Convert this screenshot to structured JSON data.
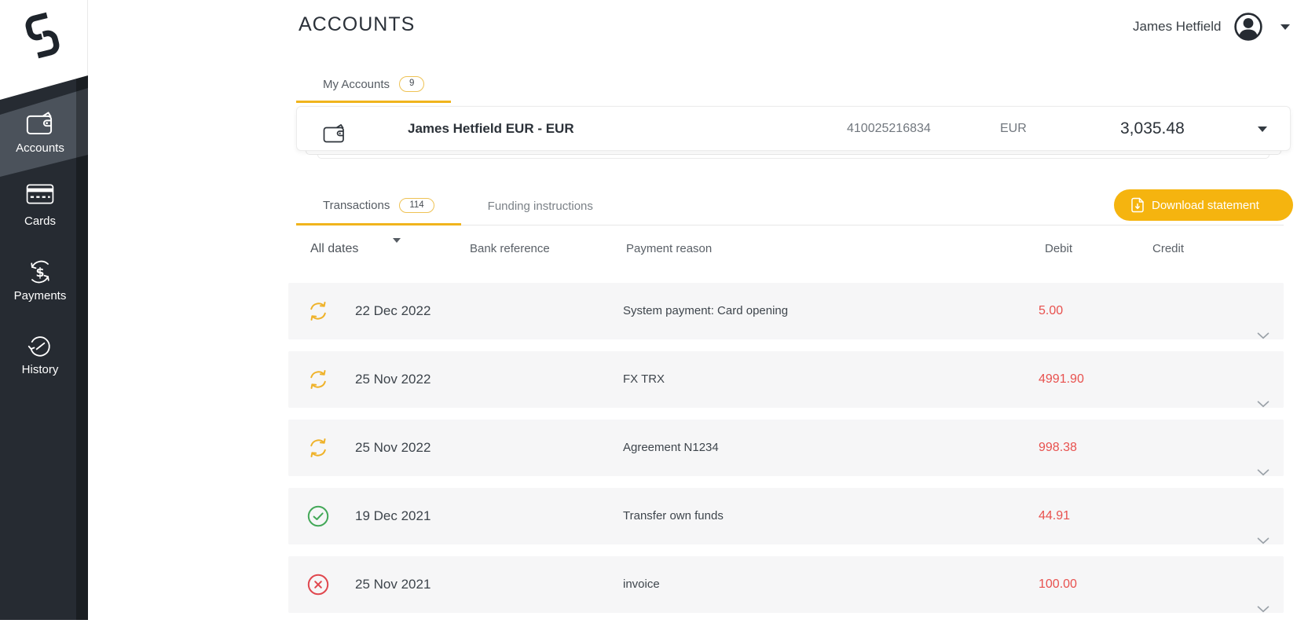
{
  "sidebar": {
    "items": [
      {
        "id": "accounts",
        "label": "Accounts",
        "active": true
      },
      {
        "id": "cards",
        "label": "Cards",
        "active": false
      },
      {
        "id": "payments",
        "label": "Payments",
        "active": false
      },
      {
        "id": "history",
        "label": "History",
        "active": false
      }
    ]
  },
  "header": {
    "title": "ACCOUNTS",
    "user_name": "James Hetfield"
  },
  "account_tabs": {
    "my_accounts": {
      "label": "My Accounts",
      "badge": "9"
    }
  },
  "account": {
    "name": "James Hetfield EUR - EUR",
    "number": "410025216834",
    "currency": "EUR",
    "balance": "3,035.48"
  },
  "transaction_tabs": {
    "transactions": {
      "label": "Transactions",
      "badge": "114"
    },
    "funding_instructions": {
      "label": "Funding instructions"
    }
  },
  "actions": {
    "download_statement": "Download statement"
  },
  "filters": {
    "date_filter_value": "All dates",
    "columns": {
      "bank_reference": "Bank reference",
      "payment_reason": "Payment reason",
      "debit": "Debit",
      "credit": "Credit"
    }
  },
  "transactions": [
    {
      "status": "pending",
      "date": "22 Dec 2022",
      "reason": "System payment: Card opening",
      "debit": "5.00",
      "credit": ""
    },
    {
      "status": "pending",
      "date": "25 Nov 2022",
      "reason": "FX TRX",
      "debit": "4991.90",
      "credit": ""
    },
    {
      "status": "pending",
      "date": "25 Nov 2022",
      "reason": "Agreement N1234",
      "debit": "998.38",
      "credit": ""
    },
    {
      "status": "completed",
      "date": "19 Dec 2021",
      "reason": "Transfer own funds",
      "debit": "44.91",
      "credit": ""
    },
    {
      "status": "failed",
      "date": "25 Nov 2021",
      "reason": "invoice",
      "debit": "100.00",
      "credit": ""
    }
  ],
  "colors": {
    "accent_gold": "#F0B41C",
    "button_gold": "#F5B40F",
    "debit_red": "#E8514E",
    "status_pending": "#EFB229",
    "status_completed": "#43A858",
    "status_failed": "#E0474E",
    "sidebar_dark": "#262B32",
    "sidebar_active": "#4B525B",
    "row_background": "#F6F6F7"
  }
}
